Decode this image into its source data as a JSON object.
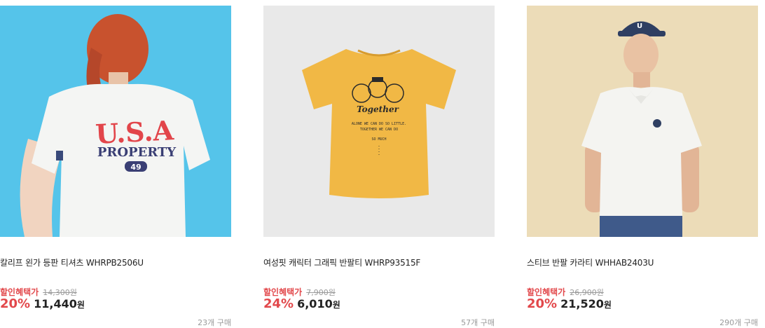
{
  "products": [
    {
      "name": "칼리프 왼가 등판 티셔츠 WHRPB2506U",
      "benefit_label": "할인혜택가",
      "original_price": "14,300원",
      "discount": "20%",
      "sale_price": "11,440",
      "currency": "원",
      "purchase_count": "23개 구매",
      "image": {
        "subject": "model-back-tshirt",
        "bg_color": "#55c4ea",
        "print_top": "U.S.A",
        "print_mid": "PROPERTY",
        "print_badge": "49"
      }
    },
    {
      "name": "여성핏 캐릭터 그래픽 반팔티 WHRP93515F",
      "benefit_label": "할인혜택가",
      "original_price": "7,900원",
      "discount": "24%",
      "sale_price": "6,010",
      "currency": "원",
      "purchase_count": "57개 구매",
      "image": {
        "subject": "yellow-tshirt-flatlay",
        "bg_color": "#e9e9e9",
        "shirt_color": "#f1b845",
        "print_script": "Together",
        "print_line1": "ALONE WE CAN DO SO LITTLE.",
        "print_line2": "TOGETHER WE CAN DO",
        "print_line3": "SO MUCH"
      }
    },
    {
      "name": "스티브 반팔 카라티 WHHAB2403U",
      "benefit_label": "할인혜택가",
      "original_price": "26,900원",
      "discount": "20%",
      "sale_price": "21,520",
      "currency": "원",
      "purchase_count": "290개 구매",
      "image": {
        "subject": "model-polo-shirt",
        "bg_color": "#ecdcb8",
        "cap_letter": "U"
      }
    }
  ],
  "colors": {
    "accent": "#e2484b",
    "muted": "#9a9a9a",
    "text": "#222222"
  }
}
